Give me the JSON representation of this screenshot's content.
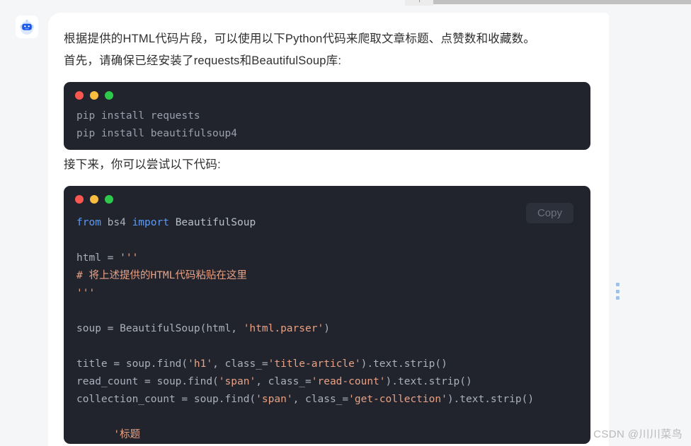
{
  "window": {
    "tab_stub_icon": "new-tab-plus-icon"
  },
  "avatar": {
    "icon": "robot-assistant-icon"
  },
  "message": {
    "paragraph_1": "根据提供的HTML代码片段，可以使用以下Python代码来爬取文章标题、点赞数和收藏数。\n首先，请确保已经安装了requests和BeautifulSoup库:",
    "paragraph_2": "接下来，你可以尝试以下代码:"
  },
  "code_block_1": {
    "window_dots": [
      "red",
      "amber",
      "green"
    ],
    "language": "shell",
    "lines": [
      "pip install requests",
      "pip install beautifulsoup4"
    ],
    "plain_text": "pip install requests\npip install beautifulsoup4"
  },
  "code_block_2": {
    "window_dots": [
      "red",
      "amber",
      "green"
    ],
    "copy_label": "Copy",
    "language": "python",
    "tokens": [
      [
        {
          "t": "from",
          "c": "kw"
        },
        {
          "t": " bs4 ",
          "c": "plain"
        },
        {
          "t": "import",
          "c": "kw"
        },
        {
          "t": " BeautifulSoup",
          "c": "name"
        }
      ],
      [],
      [
        {
          "t": "html = ",
          "c": "plain"
        },
        {
          "t": "'''",
          "c": "str"
        }
      ],
      [
        {
          "t": "# 将上述提供的HTML代码粘贴在这里",
          "c": "str"
        }
      ],
      [
        {
          "t": "'''",
          "c": "str"
        }
      ],
      [],
      [
        {
          "t": "soup = BeautifulSoup(html, ",
          "c": "plain"
        },
        {
          "t": "'html.parser'",
          "c": "str"
        },
        {
          "t": ")",
          "c": "plain"
        }
      ],
      [],
      [
        {
          "t": "title = soup.find(",
          "c": "plain"
        },
        {
          "t": "'h1'",
          "c": "str"
        },
        {
          "t": ", class_=",
          "c": "plain"
        },
        {
          "t": "'title-article'",
          "c": "str"
        },
        {
          "t": ").text.strip()",
          "c": "plain"
        }
      ],
      [
        {
          "t": "read_count = soup.find(",
          "c": "plain"
        },
        {
          "t": "'span'",
          "c": "str"
        },
        {
          "t": ", class_=",
          "c": "plain"
        },
        {
          "t": "'read-count'",
          "c": "str"
        },
        {
          "t": ").text.strip()",
          "c": "plain"
        }
      ],
      [
        {
          "t": "collection_count = soup.find(",
          "c": "plain"
        },
        {
          "t": "'span'",
          "c": "str"
        },
        {
          "t": ", class_=",
          "c": "plain"
        },
        {
          "t": "'get-collection'",
          "c": "str"
        },
        {
          "t": ").text.strip()",
          "c": "plain"
        }
      ],
      [],
      [
        {
          "t": "      '标题",
          "c": "str"
        }
      ]
    ],
    "plain_text": "from bs4 import BeautifulSoup\n\nhtml = '''\n# 将上述提供的HTML代码粘贴在这里\n'''\n\nsoup = BeautifulSoup(html, 'html.parser')\n\ntitle = soup.find('h1', class_='title-article').text.strip()\nread_count = soup.find('span', class_='read-count').text.strip()\ncollection_count = soup.find('span', class_='get-collection').text.strip()"
  },
  "side_handle": {
    "icon": "vertical-dots-drag-handle-icon"
  },
  "watermark": {
    "text": "CSDN @川川菜鸟"
  },
  "colors": {
    "page_background": "#f5f6f8",
    "card_background": "#ffffff",
    "code_background": "#21242d",
    "text": "#2f2f2f",
    "code_plain": "#9aa0ac",
    "code_keyword": "#5a9bf6",
    "code_string": "#e8a184",
    "dot_red": "#f9574f",
    "dot_amber": "#fbbd3f",
    "dot_green": "#2ec84a",
    "copy_label": "#6c727f",
    "handle_dots": "#9ec1ea",
    "watermark": "#b9b9b9"
  }
}
